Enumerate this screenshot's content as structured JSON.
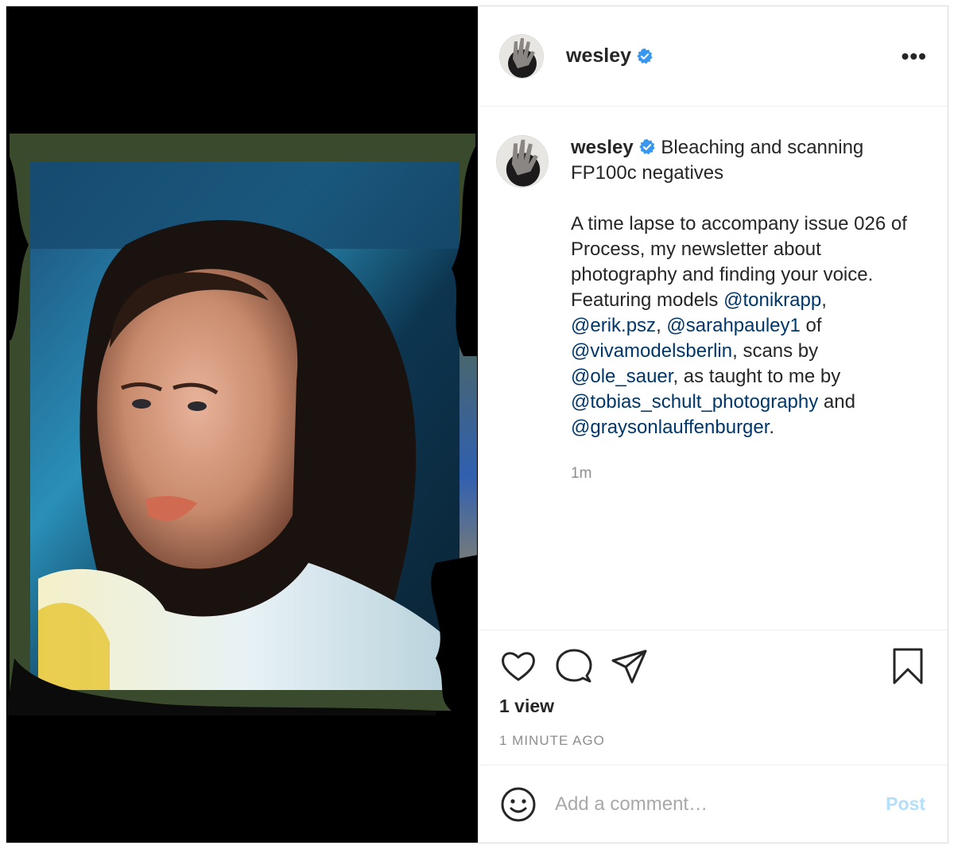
{
  "header": {
    "username": "wesley",
    "more_label": "•••"
  },
  "caption": {
    "username": "wesley",
    "title": "Bleaching and scanning FP100c negatives",
    "intro": "A time lapse to accompany issue 026 of Process, my newsletter about photography and finding your voice. Featuring models ",
    "mention_1": "@tonikrapp",
    "sep_1": ",\n",
    "mention_2": "@erik.psz",
    "sep_2": ", ",
    "mention_3": "@sarahpauley1",
    "sep_3": " of\n",
    "mention_4": "@vivamodelsberlin",
    "sep_4": ", scans by\n",
    "mention_5": "@ole_sauer",
    "sep_5": ", as taught to me by\n",
    "mention_6": "@tobias_schult_photography",
    "sep_6": " and\n",
    "mention_7": "@graysonlauffenburger",
    "end": ".",
    "time": "1m"
  },
  "stats": {
    "views": "1 view",
    "ago": "1 MINUTE AGO"
  },
  "comment": {
    "placeholder": "Add a comment…",
    "post_label": "Post"
  },
  "icons": {
    "like": "heart-icon",
    "comment": "comment-bubble-icon",
    "share": "paper-plane-icon",
    "save": "bookmark-icon",
    "emoji": "smiley-icon",
    "verified": "verified-badge-icon"
  },
  "colors": {
    "verified": "#3897f0",
    "mention": "#00376b",
    "post_disabled": "#b2dffc",
    "muted": "#8e8e8e"
  }
}
